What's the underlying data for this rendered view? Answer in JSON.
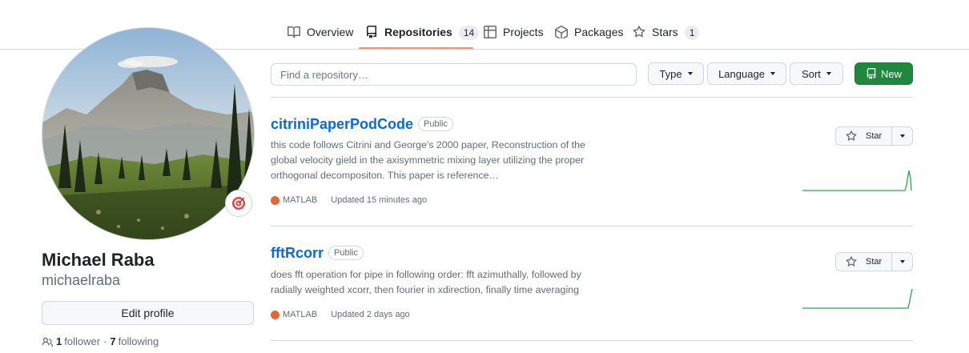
{
  "nav": {
    "tabs": [
      {
        "label": "Overview",
        "icon": "book-icon"
      },
      {
        "label": "Repositories",
        "icon": "repo-icon",
        "count": "14",
        "active": true
      },
      {
        "label": "Projects",
        "icon": "table-icon"
      },
      {
        "label": "Packages",
        "icon": "package-icon"
      },
      {
        "label": "Stars",
        "icon": "star-icon",
        "count": "1"
      }
    ]
  },
  "profile": {
    "name": "Michael Raba",
    "login": "michaelraba",
    "status_icon": "target-icon",
    "edit_label": "Edit profile",
    "followers_count": "1",
    "followers_label": "follower",
    "separator": "·",
    "following_count": "7",
    "following_label": "following"
  },
  "filters": {
    "search_placeholder": "Find a repository…",
    "type_label": "Type",
    "language_label": "Language",
    "sort_label": "Sort",
    "new_label": "New"
  },
  "repos": [
    {
      "name": "citriniPaperPodCode",
      "visibility": "Public",
      "description": "this code follows Citrini and George's 2000 paper, Reconstruction of the global velocity gield in the axisymmetric mixing layer utilizing the proper orthogonal decompositon. This paper is reference…",
      "language": "MATLAB",
      "language_color": "#e16737",
      "updated": "Updated 15 minutes ago",
      "star_label": "Star"
    },
    {
      "name": "fftRcorr",
      "visibility": "Public",
      "description": "does fft operation for pipe in following order: fft azimuthally, followed by radially weighted xcorr, then fourier in xdirection, finally time averaging",
      "language": "MATLAB",
      "language_color": "#e16737",
      "updated": "Updated 2 days ago",
      "star_label": "Star"
    }
  ],
  "colors": {
    "accent_link": "#0969da",
    "new_button": "#1f883d",
    "tab_underline": "#fd8c73",
    "sparkline": "#2da44e"
  }
}
